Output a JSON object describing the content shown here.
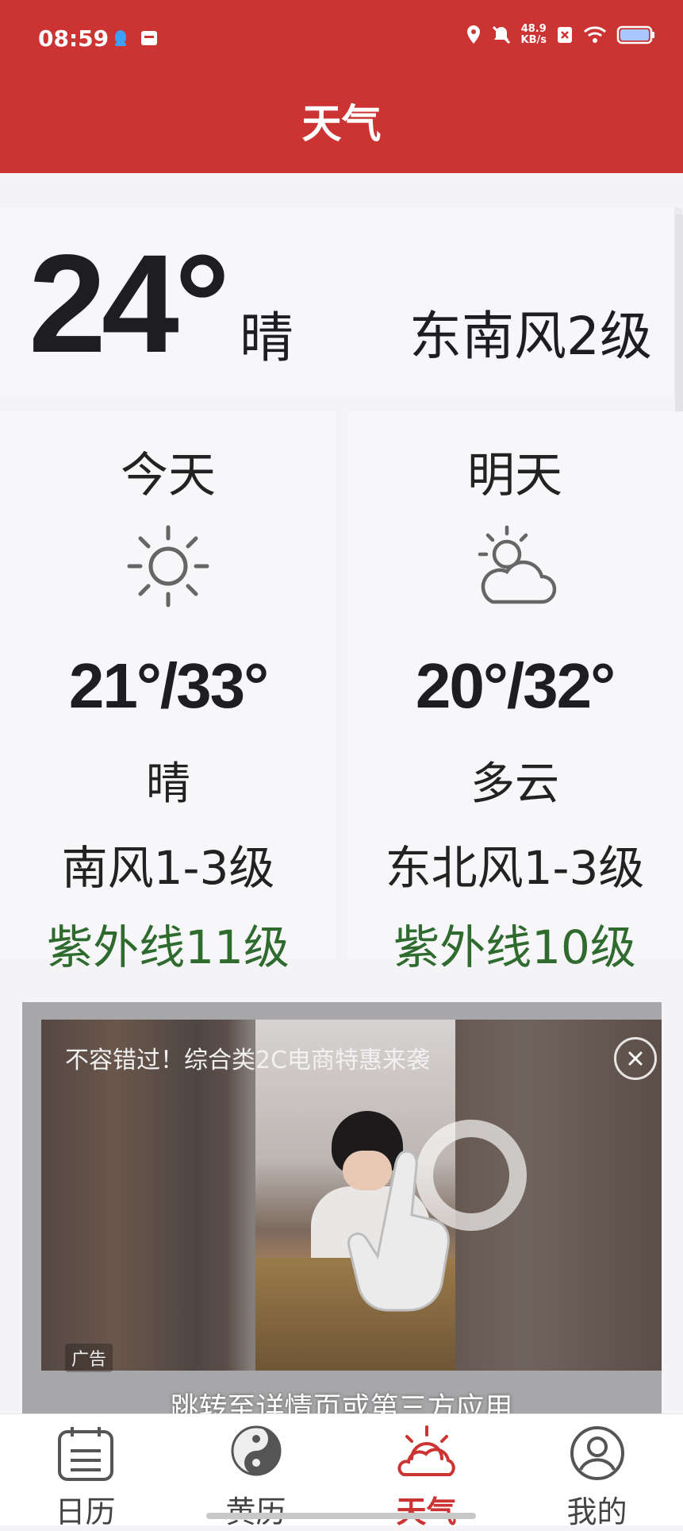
{
  "status_bar": {
    "time": "08:59",
    "net_speed_value": "48.9",
    "net_speed_unit": "KB/s"
  },
  "header": {
    "title": "天气"
  },
  "current": {
    "temperature": "24°",
    "condition": "晴",
    "wind": "东南风2级"
  },
  "forecast": [
    {
      "day": "今天",
      "icon": "sun-icon",
      "range": "21°/33°",
      "condition": "晴",
      "wind": "南风1-3级",
      "uv": "紫外线11级"
    },
    {
      "day": "明天",
      "icon": "partly-cloudy-icon",
      "range": "20°/32°",
      "condition": "多云",
      "wind": "东北风1-3级",
      "uv": "紫外线10级"
    }
  ],
  "ad": {
    "title": "不容错过！综合类2C电商特惠来袭",
    "badge": "广告",
    "cta": "跳转至详情页或第三方应用"
  },
  "tabs": [
    {
      "label": "日历",
      "icon": "calendar-icon"
    },
    {
      "label": "黄历",
      "icon": "yin-yang-icon"
    },
    {
      "label": "天气",
      "icon": "weather-sun-icon"
    },
    {
      "label": "我的",
      "icon": "profile-icon"
    }
  ],
  "colors": {
    "brand": "#cc3333",
    "uv_text": "#2f6b2f"
  }
}
